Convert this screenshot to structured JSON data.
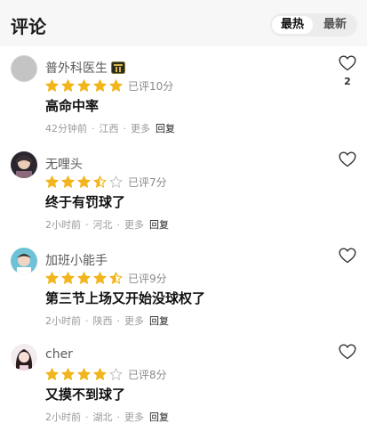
{
  "header": {
    "title": "评论",
    "tabs": [
      {
        "label": "最热",
        "active": true
      },
      {
        "label": "最新",
        "active": false
      }
    ]
  },
  "colors": {
    "star_filled": "#f2b51c",
    "star_empty": "#c8c8c8",
    "meta_text": "#9a9a9a"
  },
  "comments": [
    {
      "username": "普外科医生",
      "has_badge": true,
      "rating": 5,
      "rated_label": "已评10分",
      "text": "高命中率",
      "time": "42分钟前",
      "location": "江西",
      "more": "更多",
      "reply": "回复",
      "likes": "2"
    },
    {
      "username": "无哩头",
      "has_badge": false,
      "rating": 3.5,
      "rated_label": "已评7分",
      "text": "终于有罚球了",
      "time": "2小时前",
      "location": "河北",
      "more": "更多",
      "reply": "回复",
      "likes": ""
    },
    {
      "username": "加班小能手",
      "has_badge": false,
      "rating": 4.5,
      "rated_label": "已评9分",
      "text": "第三节上场又开始没球权了",
      "time": "2小时前",
      "location": "陕西",
      "more": "更多",
      "reply": "回复",
      "likes": ""
    },
    {
      "username": "cher",
      "has_badge": false,
      "rating": 4,
      "rated_label": "已评8分",
      "text": "又摸不到球了",
      "time": "2小时前",
      "location": "湖北",
      "more": "更多",
      "reply": "回复",
      "likes": ""
    }
  ]
}
